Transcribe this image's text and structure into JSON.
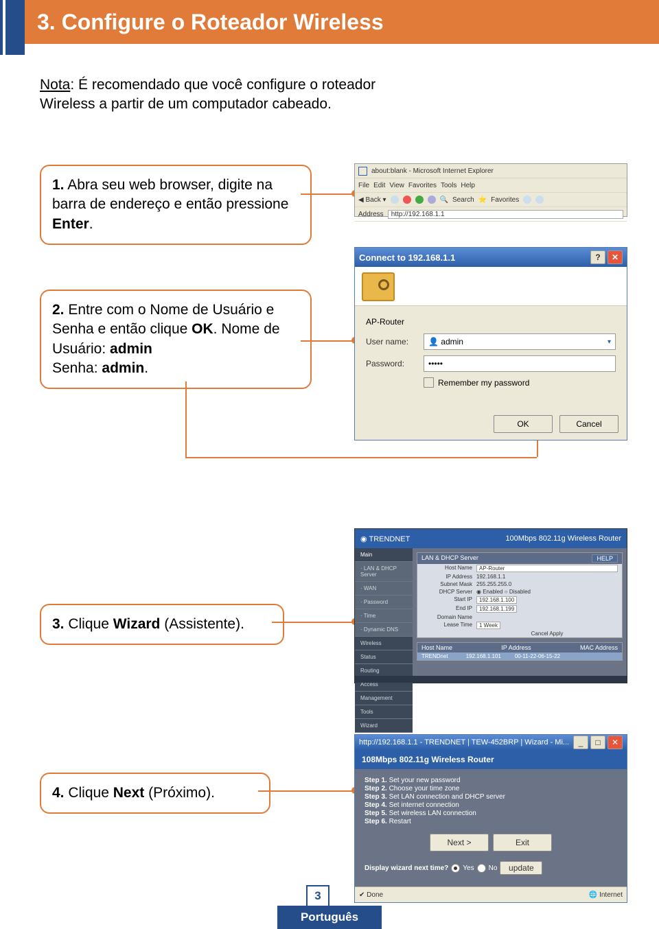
{
  "header": {
    "title": "3. Configure o Roteador Wireless"
  },
  "note": {
    "label": "Nota",
    "text": ": É recomendado que você configure o roteador Wireless a partir de um computador cabeado."
  },
  "steps": {
    "s1": {
      "num": "1.",
      "text_a": " Abra seu web browser, digite  na barra de endereço e então pressione ",
      "bold": "Enter",
      "text_b": "."
    },
    "s2": {
      "num": "2.",
      "text_a": " Entre com o Nome de Usuário e Senha e então clique ",
      "bold": "OK",
      "text_b": ". Nome de Usuário: ",
      "v1": "admin",
      "text_c": " Senha: ",
      "v2": "admin",
      "text_d": "."
    },
    "s3": {
      "num": "3.",
      "text_a": " Clique ",
      "bold": "Wizard",
      "text_b": " (Assistente)."
    },
    "s4": {
      "num": "4.",
      "text_a": " Clique ",
      "bold": "Next",
      "text_b": " (Próximo)."
    }
  },
  "ie": {
    "title": "about:blank - Microsoft Internet Explorer",
    "menu": [
      "File",
      "Edit",
      "View",
      "Favorites",
      "Tools",
      "Help"
    ],
    "search": "Search",
    "fav": "Favorites",
    "addr_label": "Address",
    "addr": "http://192.168.1.1"
  },
  "dialog": {
    "title": "Connect to 192.168.1.1",
    "realm": "AP-Router",
    "user_label": "User name:",
    "user": "admin",
    "pass_label": "Password:",
    "pass": "•••••",
    "remember": "Remember my password",
    "ok": "OK",
    "cancel": "Cancel",
    "help": "?",
    "close": "✕"
  },
  "router": {
    "brand": "TRENDNET",
    "model": "100Mbps 802.11g Wireless Router",
    "nav": [
      "Main",
      "· LAN & DHCP Server",
      "· WAN",
      "· Password",
      "· Time",
      "· Dynamic DNS",
      "Wireless",
      "Status",
      "Routing",
      "Access",
      "Management",
      "Tools",
      "Wizard"
    ],
    "panel_title": "LAN & DHCP Server",
    "panel_btn": "HELP",
    "rows": [
      [
        "Host Name",
        "AP-Router"
      ],
      [
        "IP Address",
        "192.168.1.1"
      ],
      [
        "Subnet Mask",
        "255.255.255.0"
      ],
      [
        "DHCP Server",
        "◉ Enabled ○ Disabled"
      ],
      [
        "Start IP",
        "192.168.1.100"
      ],
      [
        "End IP",
        "192.168.1.199"
      ],
      [
        "Domain Name",
        ""
      ],
      [
        "Lease Time",
        "1 Week"
      ]
    ],
    "actions": "Cancel  Apply",
    "table_hdr": [
      "Host Name",
      "IP Address",
      "MAC Address"
    ],
    "table_row": [
      "TRENDnet",
      "192.168.1.101",
      "00-11-22-06-15-22"
    ]
  },
  "wizard": {
    "titlebar": "http://192.168.1.1 - TRENDNET | TEW-452BRP | Wizard - Mi...",
    "band": "108Mbps 802.11g Wireless Router",
    "steps": [
      {
        "b": "Step 1.",
        "t": " Set your new password"
      },
      {
        "b": "Step 2.",
        "t": " Choose your time zone"
      },
      {
        "b": "Step 3.",
        "t": " Set LAN connection and DHCP server"
      },
      {
        "b": "Step 4.",
        "t": " Set internet connection"
      },
      {
        "b": "Step 5.",
        "t": " Set wireless LAN connection"
      },
      {
        "b": "Step 6.",
        "t": " Restart"
      }
    ],
    "next": "Next >",
    "exit": "Exit",
    "q": "Display wizard next time?",
    "yes": "Yes",
    "no": "No",
    "update": "update",
    "done": "Done",
    "inet": "Internet",
    "tb_min": "_",
    "tb_max": "□",
    "tb_close": "✕"
  },
  "footer": {
    "page": "3",
    "lang": "Português"
  }
}
